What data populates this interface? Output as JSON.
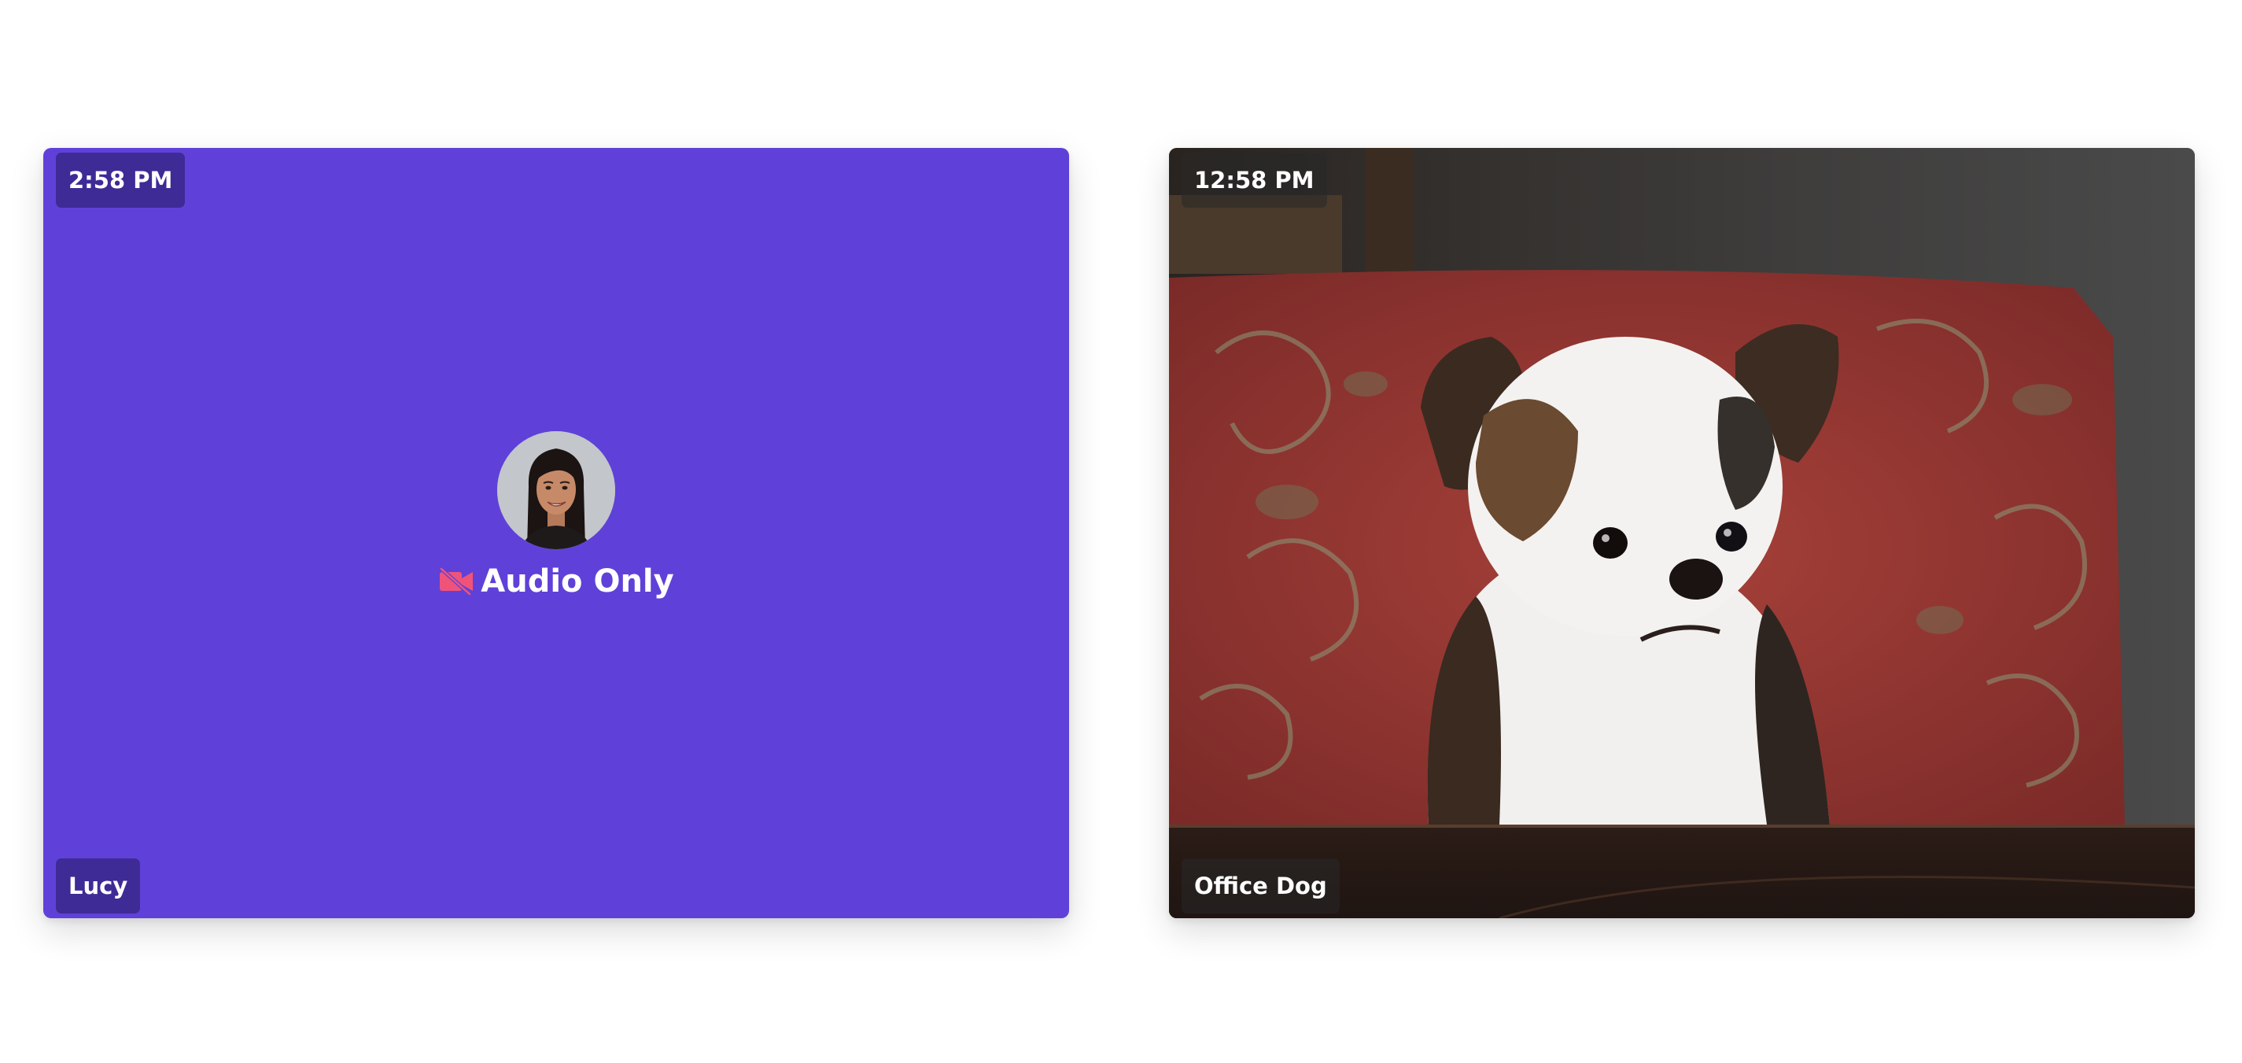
{
  "participants": [
    {
      "name": "Lucy",
      "time": "2:58 PM",
      "status": "Audio Only",
      "status_icon": "video-off-icon",
      "tile_color": "#5f41d9"
    },
    {
      "name": "Office Dog",
      "time": "12:58 PM"
    }
  ]
}
